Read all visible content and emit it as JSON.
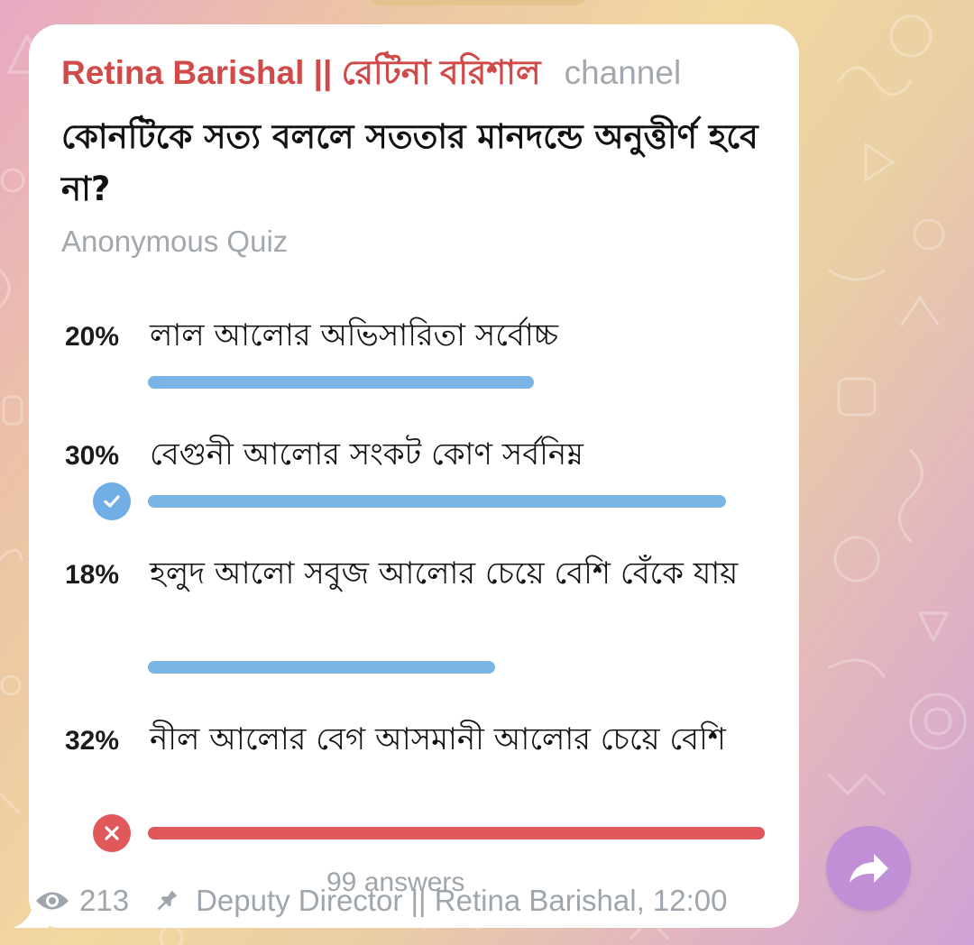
{
  "channel": {
    "name": "Retina Barishal || রেটিনা বরিশাল",
    "tag": "channel"
  },
  "poll": {
    "question": "কোনটিকে সত্য বললে সততার মানদন্ডে অনুত্তীর্ণ হবে না?",
    "type": "Anonymous Quiz",
    "options": [
      {
        "percent": "20%",
        "text": "লাল আলোর অভিসারিতা সর্বোচ্চ",
        "share": 0.2,
        "state": "none"
      },
      {
        "percent": "30%",
        "text": "বেগুনী আলোর সংকট কোণ সর্বনিম্ন",
        "share": 0.3,
        "state": "correct"
      },
      {
        "percent": "18%",
        "text": "হলুদ আলো সবুজ আলোর চেয়ে বেশি বেঁকে যায়",
        "share": 0.18,
        "state": "none"
      },
      {
        "percent": "32%",
        "text": "নীল আলোর বেগ আসমানী আলোর চেয়ে বেশি",
        "share": 0.32,
        "state": "incorrect"
      }
    ],
    "answers_label": "99 answers"
  },
  "footer": {
    "views": "213",
    "author_time": "Deputy Director || Retina Barishal, 12:00"
  },
  "icons": {
    "views": "eye-icon",
    "pin": "pin-icon",
    "correct": "check-icon",
    "incorrect": "close-icon",
    "share": "share-arrow-icon"
  },
  "colors": {
    "channel_name": "#d04a49",
    "bar_default": "#7ab5e6",
    "bar_wrong": "#e1585a",
    "correct_badge": "#72aee6",
    "incorrect_badge": "#e1585a",
    "share_button": "#c18fd6",
    "meta_gray": "#9ea5ad"
  }
}
